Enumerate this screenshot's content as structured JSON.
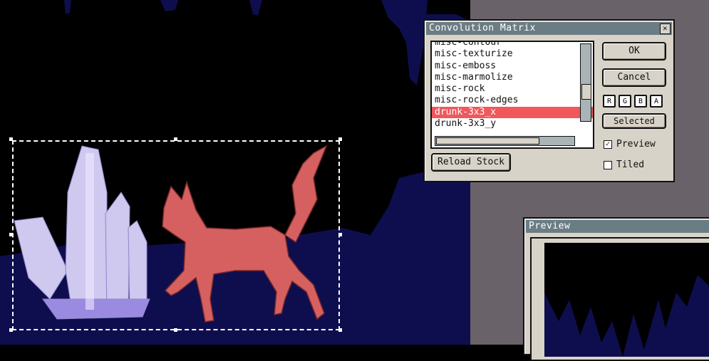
{
  "dialog": {
    "title": "Convolution Matrix",
    "list_items": [
      "misc-contour",
      "misc-texturize",
      "misc-emboss",
      "misc-marmolize",
      "misc-rock",
      "misc-rock-edges",
      "drunk-3x3_x",
      "drunk-3x3_y"
    ],
    "selected_index": 6,
    "ok_label": "OK",
    "cancel_label": "Cancel",
    "channels": [
      "R",
      "G",
      "B",
      "A"
    ],
    "selected_label": "Selected",
    "preview_label": "Preview",
    "preview_checked": true,
    "tiled_label": "Tiled",
    "tiled_checked": false,
    "reload_label": "Reload Stock"
  },
  "preview_window": {
    "title": "Preview"
  },
  "colors": {
    "night_sky": "#000000",
    "ground": "#0e0e4e",
    "cat": "#d66060",
    "crystal": "#cfc8ef",
    "desktop": "#6a6269",
    "titlebar": "#6b7d84",
    "selection_highlight": "#f0585c"
  }
}
